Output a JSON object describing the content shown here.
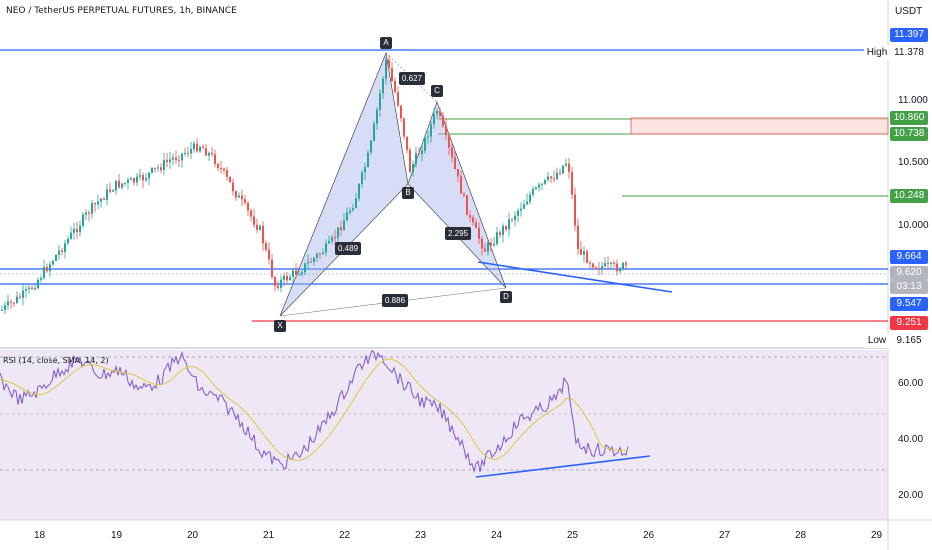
{
  "header": {
    "title": "NEO / TetherUS PERPETUAL FUTURES, 1h, BINANCE",
    "currency": "USDT"
  },
  "rsi": {
    "title": "RSI (14, close, SMA, 14, 2)"
  },
  "price_axis": {
    "ticks": [
      "11.000",
      "10.500",
      "10.000"
    ]
  },
  "rsi_axis": {
    "ticks": [
      "60.00",
      "40.00",
      "20.00"
    ]
  },
  "time_axis": {
    "ticks": [
      "18",
      "19",
      "20",
      "21",
      "22",
      "23",
      "24",
      "25",
      "26",
      "27",
      "28",
      "29"
    ]
  },
  "price_labels": {
    "high_value": "11.397",
    "high_name": "High",
    "high_close": "11.378",
    "red_top": "10.860",
    "green_top": "10.738",
    "green_mid": "10.248",
    "blue_mid": "9.664",
    "last_price": "9.620",
    "countdown": "03:13",
    "blue_low": "9.547",
    "red_low": "9.251",
    "low_name": "Low",
    "low_value": "9.165"
  },
  "pattern": {
    "points": [
      "X",
      "A",
      "B",
      "C",
      "D"
    ],
    "ratios": {
      "xa_ab": "0.627",
      "xb": "0.489",
      "bc_cd": "2.295",
      "xd": "0.886"
    }
  },
  "colors": {
    "up": "#26a69a",
    "down": "#ef5350",
    "blue_line": "#2962ff",
    "green_line": "#43a047",
    "red_line": "#f23645",
    "pattern_fill": "#a4b4e8",
    "rsi_line": "#7e57c2",
    "rsi_ma": "#e0c843",
    "last_price_bg": "#b2b5be"
  }
}
